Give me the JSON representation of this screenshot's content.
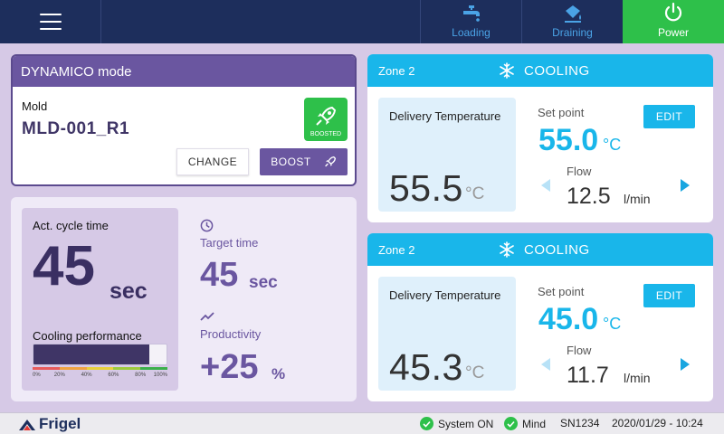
{
  "topbar": {
    "buttons": [
      {
        "label": "Loading",
        "icon": "faucet-icon"
      },
      {
        "label": "Draining",
        "icon": "bucket-drain-icon"
      },
      {
        "label": "Power",
        "icon": "power-icon"
      }
    ],
    "power_color": "#2ec04a"
  },
  "mode": {
    "title": "DYNAMICO mode",
    "mold_label": "Mold",
    "mold_value": "MLD-001_R1",
    "badge_label": "BOOSTED",
    "change_label": "CHANGE",
    "boost_label": "BOOST"
  },
  "cycle": {
    "act_label": "Act. cycle time",
    "act_value": "45",
    "act_unit": "sec",
    "perf_label": "Cooling performance",
    "perf_level_percent": 87,
    "perf_ticks": [
      "0%",
      "20%",
      "40%",
      "60%",
      "80%",
      "100%"
    ],
    "target_label": "Target time",
    "target_value": "45",
    "target_unit": "sec",
    "prod_label": "Productivity",
    "prod_value": "+25",
    "prod_unit": "%"
  },
  "zones": [
    {
      "name": "Zone 2",
      "mode": "COOLING",
      "delivery_label": "Delivery Temperature",
      "delivery_value": "55.5",
      "delivery_unit": "°C",
      "setpoint_label": "Set point",
      "setpoint_value": "55.0",
      "setpoint_unit": "°C",
      "edit_label": "EDIT",
      "flow_label": "Flow",
      "flow_value": "12.5",
      "flow_unit": "l/min"
    },
    {
      "name": "Zone 2",
      "mode": "COOLING",
      "delivery_label": "Delivery Temperature",
      "delivery_value": "45.3",
      "delivery_unit": "°C",
      "setpoint_label": "Set point",
      "setpoint_value": "45.0",
      "setpoint_unit": "°C",
      "edit_label": "EDIT",
      "flow_label": "Flow",
      "flow_value": "11.7",
      "flow_unit": "l/min"
    }
  ],
  "footer": {
    "brand": "Frigel",
    "system_status": "System ON",
    "mind_status": "Mind",
    "serial": "SN1234",
    "datetime": "2020/01/29 - 10:24"
  },
  "colors": {
    "navy": "#1d2e5c",
    "purple": "#6a56a0",
    "cyan": "#19b6ea",
    "green": "#2ec04a"
  }
}
